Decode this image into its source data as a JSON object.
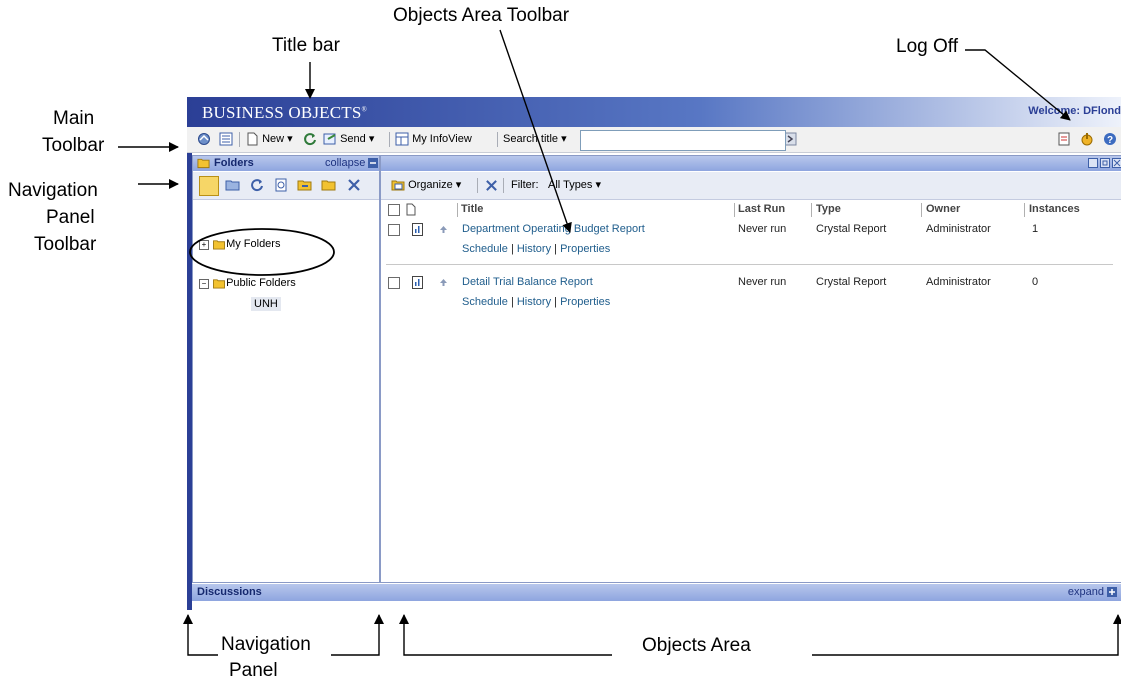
{
  "callouts": {
    "objects_area_toolbar": "Objects Area Toolbar",
    "title_bar": "Title bar",
    "log_off": "Log Off",
    "main_toolbar_1": "Main",
    "main_toolbar_2": "Toolbar",
    "nav_toolbar_1": "Navigation",
    "nav_toolbar_2": "Panel",
    "nav_toolbar_3": "Toolbar",
    "nav_panel_1": "Navigation",
    "nav_panel_2": "Panel",
    "objects_area": "Objects Area"
  },
  "app": {
    "brand": "BUSINESS OBJECTS",
    "brand_mark": "®",
    "welcome": "Welcome: DFlond"
  },
  "main_toolbar": {
    "new_label": "New",
    "send_label": "Send",
    "my_infoview_label": "My InfoView",
    "search_label": "Search title",
    "search_value": ""
  },
  "nav_panel": {
    "header": "Folders",
    "collapse": "collapse",
    "tree": [
      {
        "label": "My Folders"
      },
      {
        "label": "Public Folders"
      },
      {
        "label": "UNH"
      }
    ]
  },
  "objects_toolbar": {
    "organize_label": "Organize",
    "filter_label": "Filter:",
    "filter_value": "All Types"
  },
  "table": {
    "columns": [
      "Title",
      "Last Run",
      "Type",
      "Owner",
      "Instances"
    ],
    "rows": [
      {
        "title": "Department Operating Budget Report",
        "last_run": "Never run",
        "type": "Crystal Report",
        "owner": "Administrator",
        "instances": "1",
        "actions": [
          "Schedule",
          "History",
          "Properties"
        ]
      },
      {
        "title": "Detail Trial Balance Report",
        "last_run": "Never run",
        "type": "Crystal Report",
        "owner": "Administrator",
        "instances": "0",
        "actions": [
          "Schedule",
          "History",
          "Properties"
        ]
      }
    ],
    "action_separator": "|"
  },
  "discussions": {
    "label": "Discussions",
    "expand": "expand"
  },
  "colors": {
    "title_dark": "#2b3f96",
    "panel_header": "#8ea5df",
    "link": "#1f5d8c",
    "folder": "#f2c230"
  },
  "icons": [
    "home-icon",
    "list-icon",
    "new-document-icon",
    "refresh-icon",
    "send-icon",
    "my-infoview-icon",
    "go-icon",
    "preferences-icon",
    "log-off-icon",
    "help-icon",
    "folder-icon",
    "delete-icon",
    "report-icon",
    "arrow-up-icon"
  ]
}
